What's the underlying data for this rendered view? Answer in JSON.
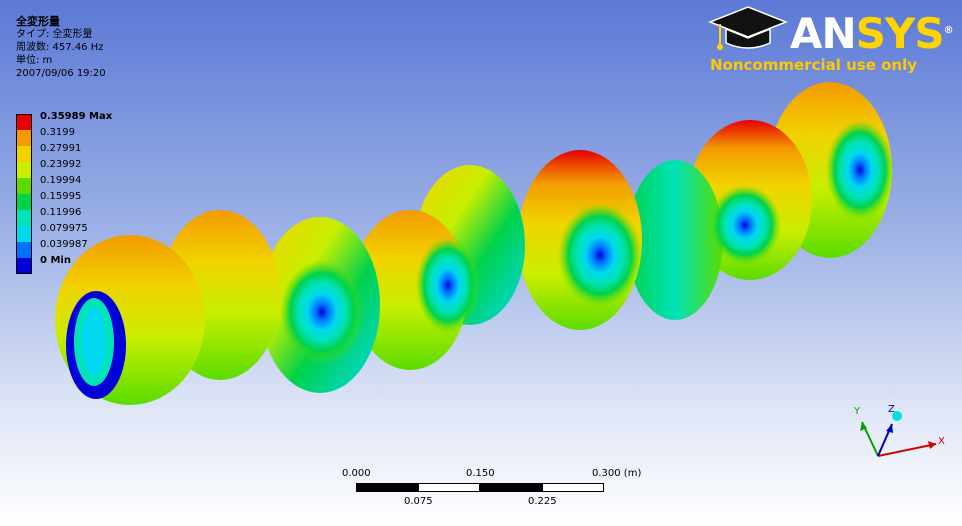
{
  "result": {
    "title": "全変形量",
    "type_line": "タイプ: 全変形量",
    "frequency_line": "周波数: 457.46 Hz",
    "unit_line": "単位: m",
    "timestamp": "2007/09/06 19:20"
  },
  "legend": {
    "entries": [
      {
        "label": "0.35989 Max",
        "color": "#e60000",
        "bold": true
      },
      {
        "label": "0.3199",
        "color": "#f39a00",
        "bold": false
      },
      {
        "label": "0.27991",
        "color": "#f1d200",
        "bold": false
      },
      {
        "label": "0.23992",
        "color": "#c8ee00",
        "bold": false
      },
      {
        "label": "0.19994",
        "color": "#5adc00",
        "bold": false
      },
      {
        "label": "0.15995",
        "color": "#00d24a",
        "bold": false
      },
      {
        "label": "0.11996",
        "color": "#00e2b8",
        "bold": false
      },
      {
        "label": "0.079975",
        "color": "#00d8f0",
        "bold": false
      },
      {
        "label": "0.039987",
        "color": "#0072ff",
        "bold": false
      },
      {
        "label": "0 Min",
        "color": "#0000d8",
        "bold": true
      }
    ]
  },
  "logo": {
    "brand_an": "AN",
    "brand_sys": "SYS",
    "registered": "®",
    "notice": "Noncommercial use only"
  },
  "scale": {
    "top_labels": [
      "0.000",
      "0.150",
      "0.300 (m)"
    ],
    "bottom_labels": [
      "0.075",
      "0.225"
    ]
  },
  "triad": {
    "x": "X",
    "y": "Y",
    "z": "Z"
  }
}
